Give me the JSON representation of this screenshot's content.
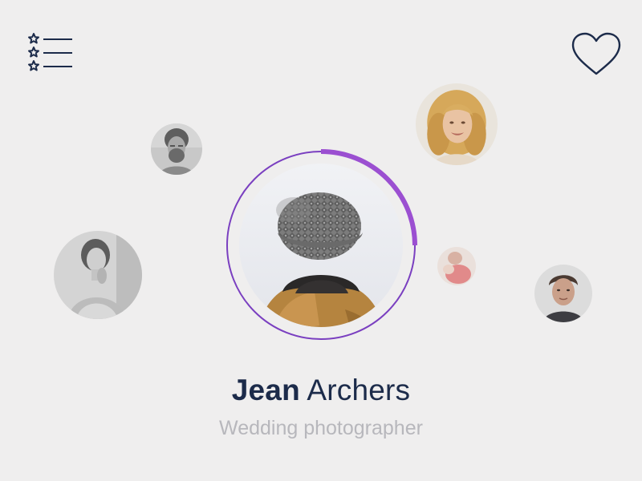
{
  "header": {
    "menu_icon": "starred-list-icon",
    "favorite_icon": "heart-outline-icon"
  },
  "profile": {
    "first_name": "Jean",
    "last_name": "Archers",
    "role": "Wedding photographer",
    "progress": 0.25,
    "progress_color": "#9b4fd1",
    "ring_color": "#7a3fc0"
  },
  "colors": {
    "background": "#efeeee",
    "name": "#1c2b4a",
    "role": "#b7b7bc",
    "icon": "#1c2b4a"
  }
}
